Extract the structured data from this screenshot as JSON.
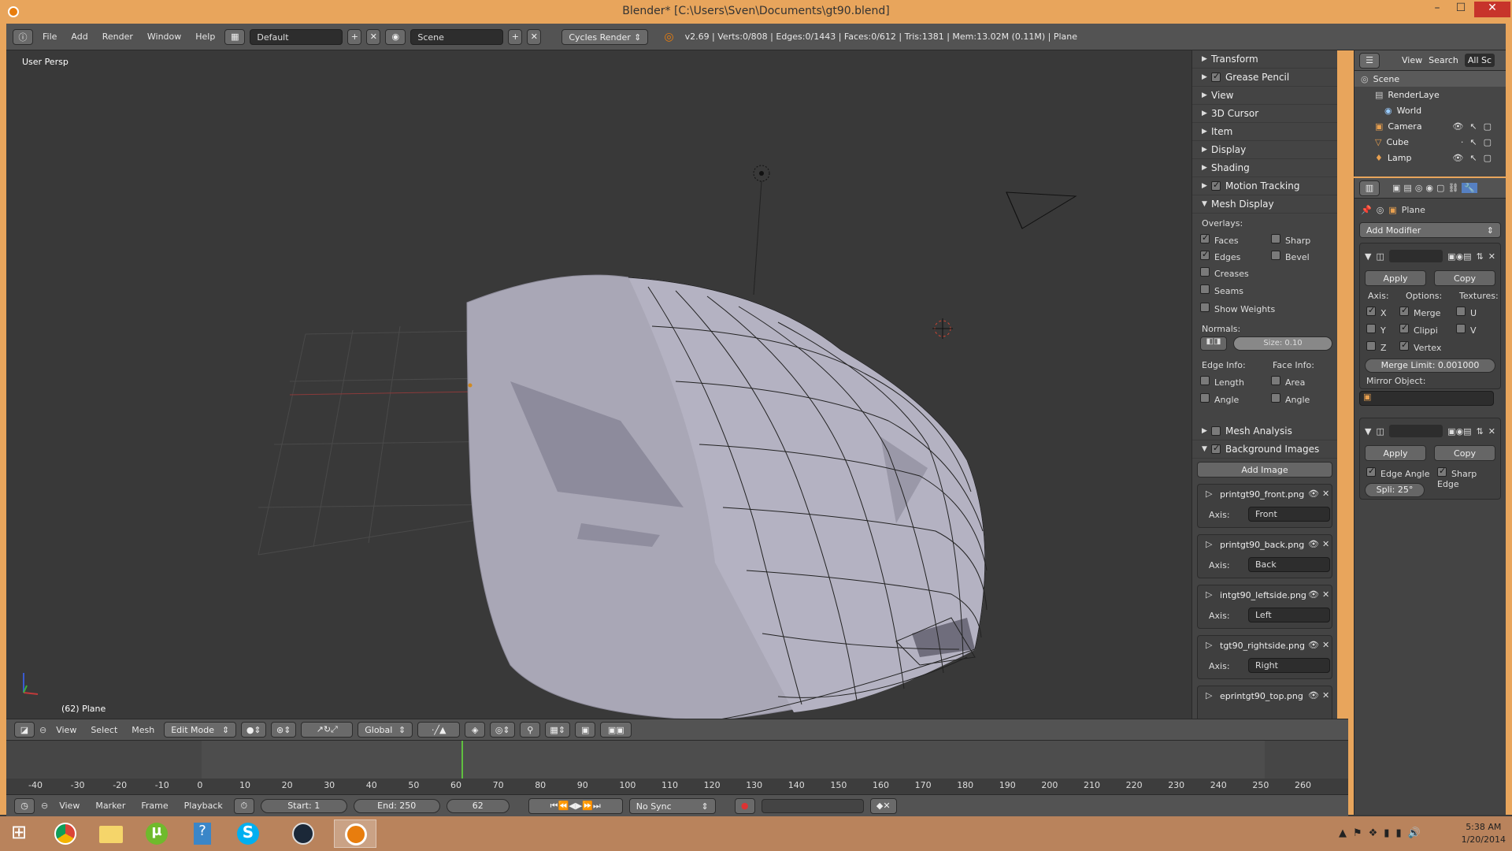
{
  "window": {
    "title": "Blender* [C:\\Users\\Sven\\Documents\\gt90.blend]",
    "minimize": "–",
    "maximize": "☐",
    "close": "✕"
  },
  "info_header": {
    "menus": [
      "File",
      "Add",
      "Render",
      "Window",
      "Help"
    ],
    "layout": "Default",
    "scene": "Scene",
    "engine": "Cycles Render",
    "stats": "v2.69 | Verts:0/808 | Edges:0/1443 | Faces:0/612 | Tris:1381 | Mem:13.02M (0.11M) | Plane"
  },
  "viewport": {
    "view_label": "User Persp",
    "object_label": "(62) Plane"
  },
  "npanel": {
    "sections": [
      "Transform",
      "Grease Pencil",
      "View",
      "3D Cursor",
      "Item",
      "Display",
      "Shading",
      "Motion Tracking",
      "Mesh Display"
    ],
    "overlays_label": "Overlays:",
    "overlays": [
      {
        "label": "Faces",
        "checked": true
      },
      {
        "label": "Sharp",
        "checked": false
      },
      {
        "label": "Edges",
        "checked": true
      },
      {
        "label": "Bevel",
        "checked": false
      },
      {
        "label": "Creases",
        "checked": false
      },
      {
        "label": "Seams",
        "checked": false
      },
      {
        "label": "Show Weights",
        "checked": false
      }
    ],
    "normals_label": "Normals:",
    "normals_size": "Size: 0.10",
    "edge_info_label": "Edge Info:",
    "face_info_label": "Face Info:",
    "edge_info": [
      "Length",
      "Angle"
    ],
    "face_info": [
      "Area",
      "Angle"
    ],
    "mesh_analysis": "Mesh Analysis",
    "background_images": "Background Images",
    "add_image": "Add Image",
    "axis_label": "Axis:",
    "images": [
      {
        "name": "printgt90_front.png",
        "axis": "Front"
      },
      {
        "name": "printgt90_back.png",
        "axis": "Back"
      },
      {
        "name": "intgt90_leftside.png",
        "axis": "Left"
      },
      {
        "name": "tgt90_rightside.png",
        "axis": "Right"
      },
      {
        "name": "eprintgt90_top.png",
        "axis": ""
      }
    ]
  },
  "outliner": {
    "view": "View",
    "search": "Search",
    "filter": "All Sc",
    "items": [
      "Scene",
      "RenderLaye",
      "World",
      "Camera",
      "Cube",
      "Lamp"
    ]
  },
  "properties": {
    "object": "Plane",
    "add_modifier": "Add Modifier",
    "apply": "Apply",
    "copy": "Copy",
    "mirror": {
      "axis_label": "Axis:",
      "options_label": "Options:",
      "textures_label": "Textures:",
      "axes": [
        {
          "label": "X",
          "checked": true
        },
        {
          "label": "Y",
          "checked": false
        },
        {
          "label": "Z",
          "checked": false
        }
      ],
      "options": [
        {
          "label": "Merge",
          "checked": true
        },
        {
          "label": "Clippi",
          "checked": true
        },
        {
          "label": "Vertex",
          "checked": true
        }
      ],
      "textures": [
        {
          "label": "U",
          "checked": false
        },
        {
          "label": "V",
          "checked": false
        }
      ],
      "merge_limit": "Merge Limit: 0.001000",
      "mirror_object_label": "Mirror Object:"
    },
    "edge_split": {
      "edge_angle": "Edge Angle",
      "sharp_edge": "Sharp Edge",
      "split": "Spli: 25°"
    }
  },
  "view_header": {
    "menus": [
      "View",
      "Select",
      "Mesh"
    ],
    "mode": "Edit Mode",
    "orientation": "Global"
  },
  "timeline": {
    "ticks": [
      "-40",
      "-30",
      "-20",
      "-10",
      "0",
      "10",
      "20",
      "30",
      "40",
      "50",
      "60",
      "70",
      "80",
      "90",
      "100",
      "110",
      "120",
      "130",
      "140",
      "150",
      "160",
      "170",
      "180",
      "190",
      "200",
      "210",
      "220",
      "230",
      "240",
      "250",
      "260"
    ],
    "menus": [
      "View",
      "Marker",
      "Frame",
      "Playback"
    ],
    "start": "Start: 1",
    "end": "End: 250",
    "current": "62",
    "sync": "No Sync"
  },
  "taskbar": {
    "time": "5:38 AM",
    "date": "1/20/2014"
  }
}
